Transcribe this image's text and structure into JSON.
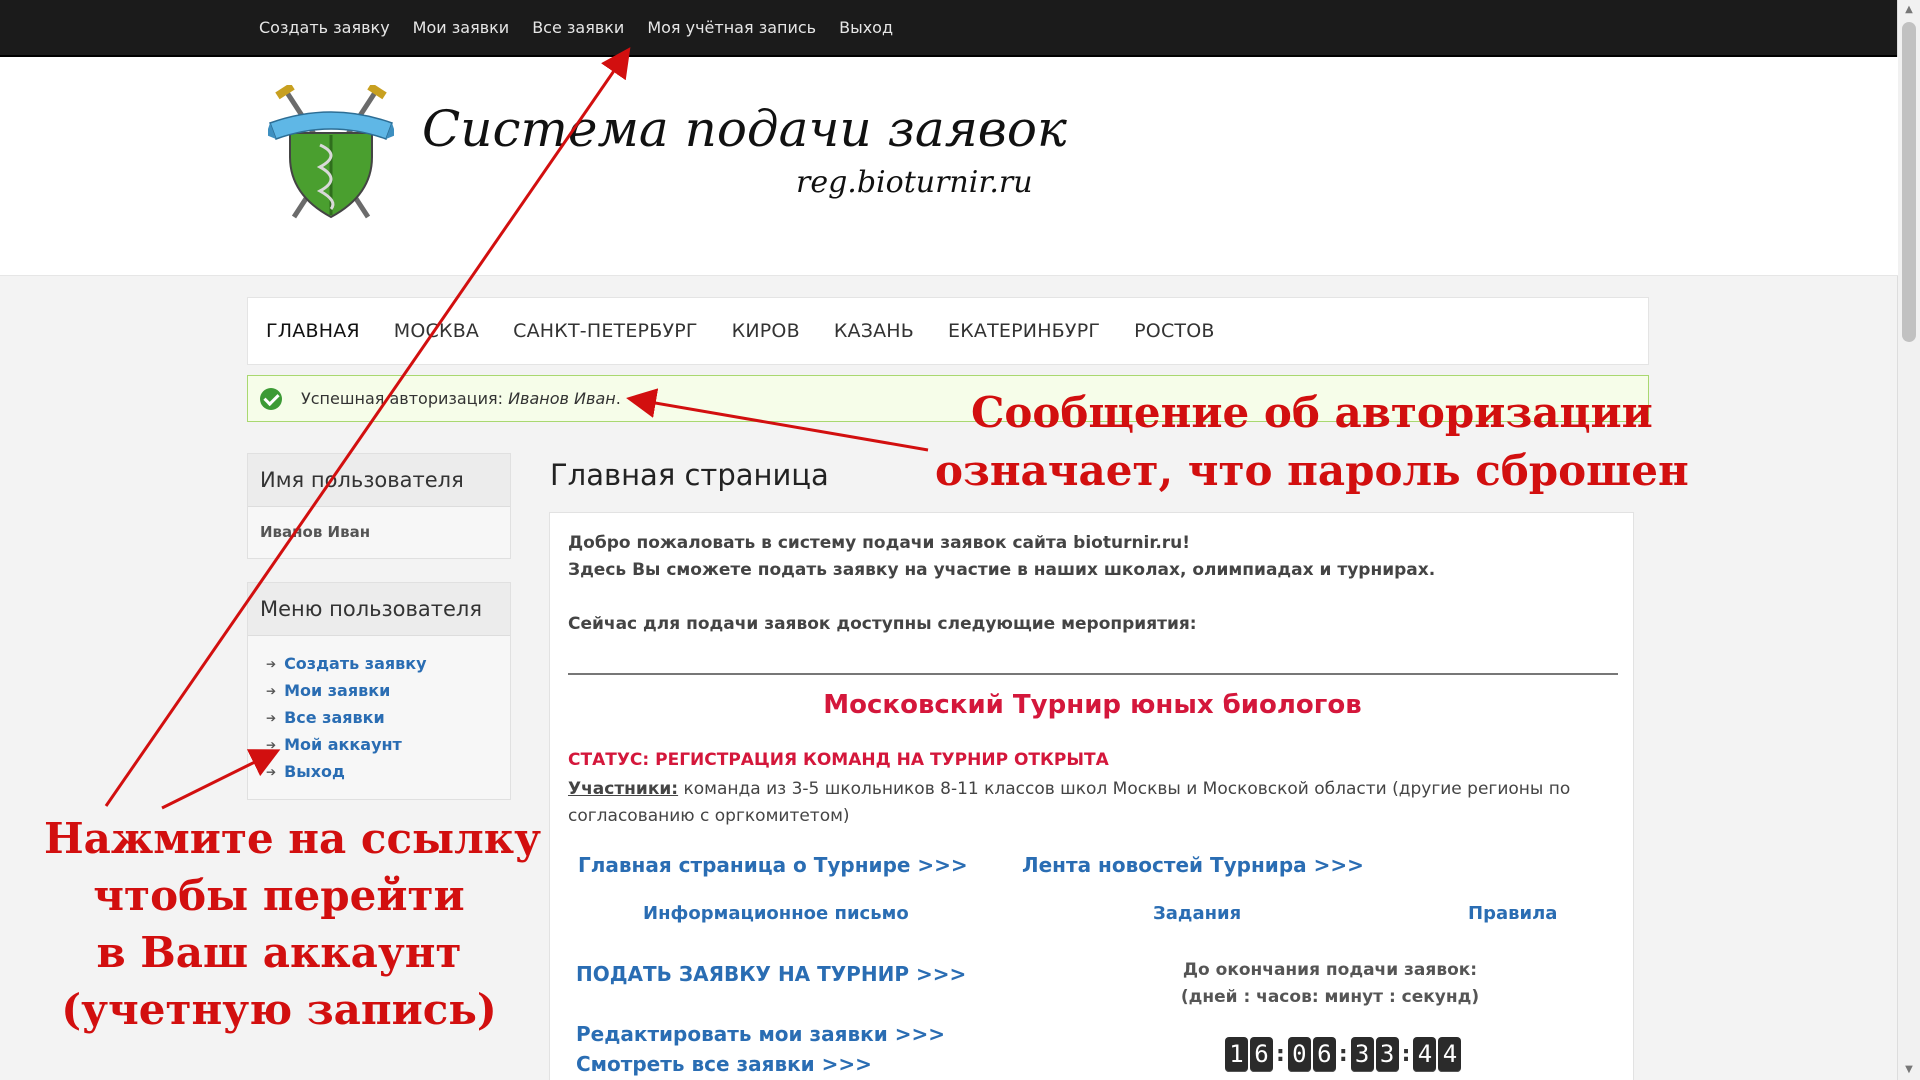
{
  "topbar": {
    "items": [
      "Создать заявку",
      "Мои заявки",
      "Все заявки",
      "Моя учётная запись",
      "Выход"
    ]
  },
  "header": {
    "logo_icon": "tournament-shield-logo-icon",
    "title": "Система подачи заявок",
    "subtitle": "reg.bioturnir.ru"
  },
  "city_menu": [
    "ГЛАВНАЯ",
    "МОСКВА",
    "САНКТ-ПЕТЕРБУРГ",
    "КИРОВ",
    "КАЗАНЬ",
    "ЕКАТЕРИНБУРГ",
    "РОСТОВ"
  ],
  "status_message": {
    "icon": "check-circle-icon",
    "text": "Успешная авторизация: ",
    "user": "Иванов Иван",
    "end": "."
  },
  "sidebar": {
    "user_block_title": "Имя пользователя",
    "user_name": "Иванов Иван",
    "menu_title": "Меню пользователя",
    "menu_items": [
      "Создать заявку",
      "Мои заявки",
      "Все заявки",
      "Мой аккаунт",
      "Выход"
    ]
  },
  "main": {
    "page_title": "Главная страница",
    "welcome1": "Добро пожаловать в систему подачи заявок сайта bioturnir.ru!",
    "welcome2": "Здесь Вы сможете подать заявку на участие в наших школах, олимпиадах и турнирах.",
    "available": "Сейчас для подачи заявок доступны следующие мероприятия:",
    "event_title": "Московский Турнир юных биологов",
    "status": "СТАТУС: РЕГИСТРАЦИЯ КОМАНД НА ТУРНИР ОТКРЫТА",
    "participants_label": "Участники:",
    "participants_text": " команда из 3-5 школьников 8-11 классов школ Москвы и Московской области (другие регионы по согласованию с оргкомитетом)",
    "link_main": "Главная страница о Турнире >>>",
    "link_news": "Лента новостей Турнира >>>",
    "link_info": "Информационное письмо",
    "link_tasks": "Задания",
    "link_rules": "Правила",
    "link_submit": "ПОДАТЬ ЗАЯВКУ НА ТУРНИР >>>",
    "link_edit": "Редактировать мои заявки >>>",
    "link_view": "Смотреть все заявки >>>",
    "countdown_caption1": "До окончания подачи заявок:",
    "countdown_caption2": "(дней : часов: минут : секунд)",
    "countdown": [
      "1",
      "6",
      "0",
      "6",
      "3",
      "3",
      "4",
      "4"
    ]
  },
  "annotations": {
    "right_line1": "Сообщение об авторизации",
    "right_line2": "означает, что пароль сброшен",
    "left_line1": "Нажмите на ссылку",
    "left_line2": "чтобы перейти",
    "left_line3": "в Ваш аккаунт",
    "left_line4": "(учетную запись)",
    "color": "#d20f0f"
  },
  "colors": {
    "link": "#2a6db3",
    "accent_red": "#d4173b",
    "topbar": "#1b1b1b",
    "success_bg": "#f6fde9"
  }
}
